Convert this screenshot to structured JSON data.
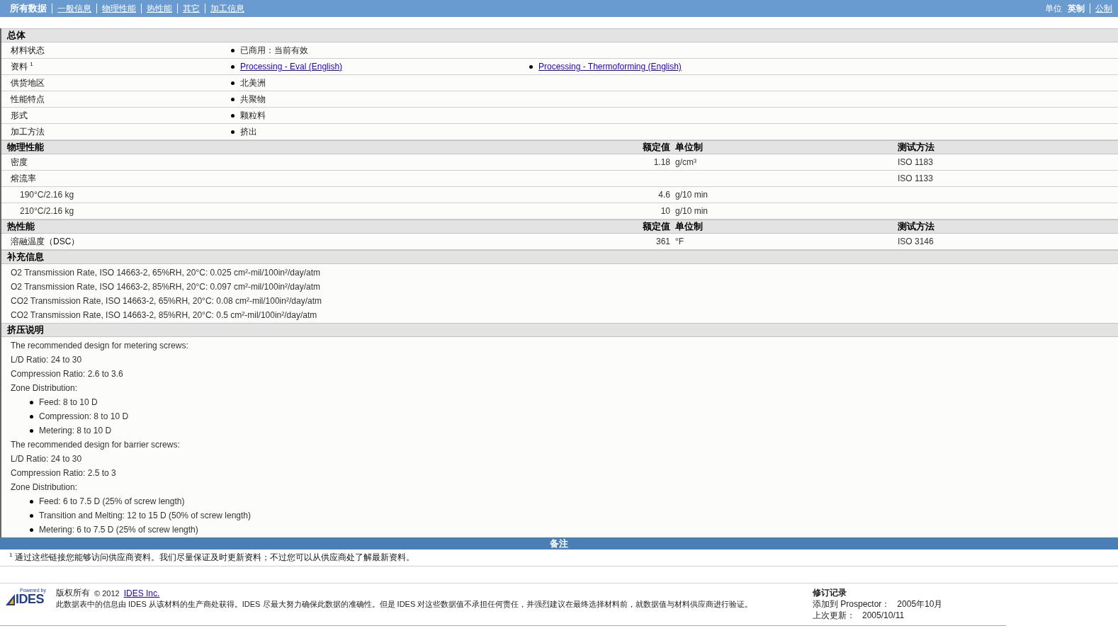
{
  "nav": {
    "items": [
      {
        "label": "所有数据",
        "selected": true
      },
      {
        "label": "一般信息",
        "selected": false
      },
      {
        "label": "物理性能",
        "selected": false
      },
      {
        "label": "热性能",
        "selected": false
      },
      {
        "label": "其它",
        "selected": false
      },
      {
        "label": "加工信息",
        "selected": false
      }
    ],
    "units": {
      "label": "单位",
      "options": [
        {
          "label": "英制",
          "selected": true
        },
        {
          "label": "公制",
          "selected": false
        }
      ]
    }
  },
  "sections": [
    {
      "kind": "general",
      "title": "总体",
      "rows": [
        {
          "label": "材料状态",
          "values": [
            {
              "text": "已商用：当前有效",
              "link": false
            }
          ]
        },
        {
          "label": "资料 $^{1}$",
          "values": [
            {
              "text": "Processing - Eval (English)",
              "link": true
            },
            {
              "text": "Processing - Thermoforming (English)",
              "link": true
            }
          ]
        },
        {
          "label": "供货地区",
          "values": [
            {
              "text": "北美洲",
              "link": false
            }
          ]
        },
        {
          "label": "性能特点",
          "values": [
            {
              "text": "共聚物",
              "link": false
            }
          ]
        },
        {
          "label": "形式",
          "values": [
            {
              "text": "颗粒料",
              "link": false
            }
          ]
        },
        {
          "label": "加工方法",
          "values": [
            {
              "text": "挤出",
              "link": false
            }
          ]
        }
      ]
    },
    {
      "kind": "properties",
      "title": "物理性能",
      "columns": [
        "额定值",
        "单位制",
        "测试方法"
      ],
      "rows": [
        {
          "label": "密度",
          "value": "1.18",
          "unit": "g/cm³",
          "method": "ISO 1183"
        },
        {
          "label": "熔流率",
          "method": "ISO 1133",
          "children": [
            {
              "label": "190°C/2.16 kg",
              "value": "4.6",
              "unit": "g/10 min"
            },
            {
              "label": "210°C/2.16 kg",
              "value": "10",
              "unit": "g/10 min"
            }
          ]
        }
      ]
    },
    {
      "kind": "properties",
      "title": "热性能",
      "columns": [
        "额定值",
        "单位制",
        "测试方法"
      ],
      "rows": [
        {
          "label": "溶融温度（DSC）",
          "value": "361",
          "unit": "°F",
          "method": "ISO 3146"
        }
      ]
    },
    {
      "kind": "text",
      "title": "补充信息",
      "lines": [
        {
          "text": "O2 Transmission Rate, ISO 14663-2, 65%RH, 20°C: 0.025 cm²-mil/100in²/day/atm"
        },
        {
          "text": "O2 Transmission Rate, ISO 14663-2, 85%RH, 20°C: 0.097 cm²-mil/100in²/day/atm"
        },
        {
          "text": "CO2 Transmission Rate, ISO 14663-2, 65%RH, 20°C: 0.08 cm²-mil/100in²/day/atm"
        },
        {
          "text": "CO2 Transmission Rate, ISO 14663-2, 85%RH, 20°C: 0.5 cm²-mil/100in²/day/atm"
        }
      ]
    },
    {
      "kind": "text",
      "title": "挤压说明",
      "lines": [
        {
          "text": "The recommended design for metering screws:"
        },
        {
          "text": "L/D Ratio: 24 to 30"
        },
        {
          "text": "Compression Ratio: 2.6 to 3.6"
        },
        {
          "text": "Zone Distribution:",
          "children": [
            {
              "text": "Feed: 8 to 10 D"
            },
            {
              "text": "Compression: 8 to 10 D"
            },
            {
              "text": "Metering: 8 to 10 D"
            }
          ]
        },
        {
          "text": "The recommended design for barrier screws:"
        },
        {
          "text": "L/D Ratio: 24 to 30"
        },
        {
          "text": "Compression Ratio: 2.5 to 3"
        },
        {
          "text": "Zone Distribution:",
          "children": [
            {
              "text": "Feed: 6 to 7.5 D (25% of screw length)"
            },
            {
              "text": "Transition and Melting: 12 to 15 D (50% of screw length)"
            },
            {
              "text": "Metering: 6 to 7.5 D (25% of screw length)"
            }
          ]
        }
      ]
    }
  ],
  "remarks": {
    "title": "备注",
    "notes": [
      "$^{1}$ 通过这些链接您能够访问供应商资料。我们尽量保证及时更新资料；不过您可以从供应商处了解最新资料。"
    ]
  },
  "footer": {
    "logo": {
      "caption": "Powered by",
      "name": "IDES"
    },
    "copyright": {
      "label": "版权所有",
      "year": "© 2012",
      "link": "IDES Inc."
    },
    "disclaimer": "此数据表中的信息由 IDES 从该材料的生产商处获得。IDES 尽最大努力确保此数据的准确性。但是 IDES 对这些数据值不承担任何责任，并强烈建议在最终选择材料前，就数据值与材料供应商进行验证。",
    "revision": {
      "title": "修订记录",
      "rows": [
        {
          "label": "添加到 Prospector：",
          "value": "2005年10月"
        },
        {
          "label": "上次更新：",
          "value": "2005/10/11"
        }
      ]
    }
  }
}
